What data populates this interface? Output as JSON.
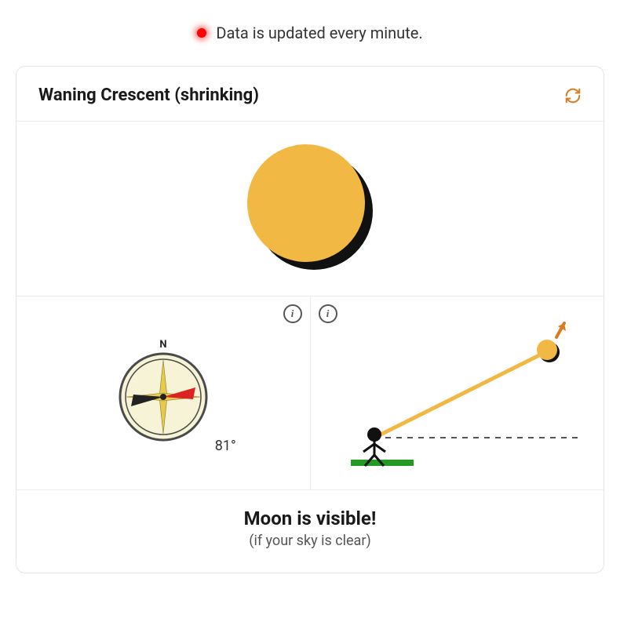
{
  "notice": {
    "text": "Data is updated every minute."
  },
  "header": {
    "title": "Waning Crescent (shrinking)"
  },
  "compass": {
    "label_north": "N",
    "heading_label": "81°"
  },
  "visibility": {
    "title": "Moon is visible!",
    "subtitle": "(if your sky is clear)"
  },
  "colors": {
    "moon": "#f2b844",
    "shadow": "#111",
    "accent": "#d97b1e",
    "compass_face": "#f7f3d6",
    "compass_ring": "#4a4a4a",
    "ground": "#239b23",
    "red": "#d22"
  }
}
